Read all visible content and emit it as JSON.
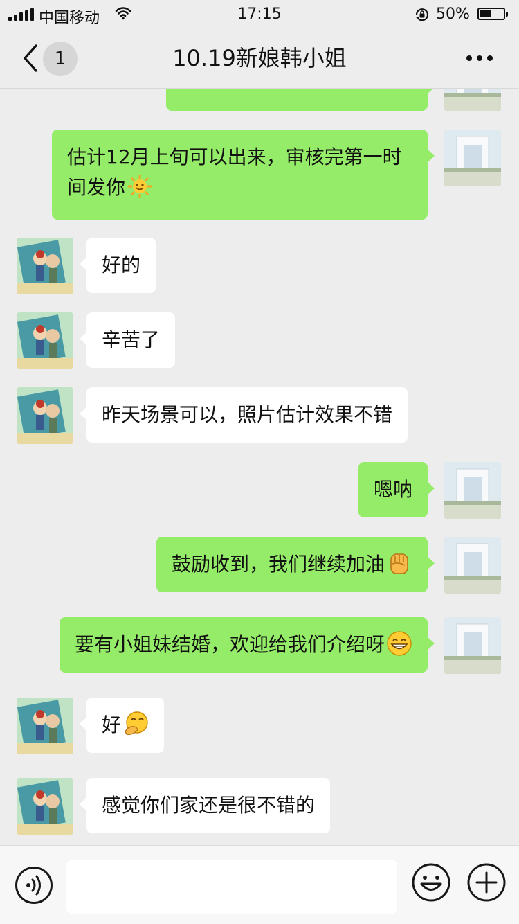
{
  "status_bar": {
    "carrier": "中国移动",
    "time": "17:15",
    "battery_percent": "50%",
    "battery_level": 0.5
  },
  "nav": {
    "unread_count": "1",
    "title": "10.19新娘韩小姐",
    "more_icon": "more-dots-icon",
    "back_icon": "chevron-left-icon"
  },
  "messages": [
    {
      "sender": "me",
      "text": "估计12月上旬可以出来，审核完第一时",
      "text2": "间发你",
      "emoji": "sun-emoji"
    },
    {
      "sender": "other",
      "text": "好的"
    },
    {
      "sender": "other",
      "text": "辛苦了"
    },
    {
      "sender": "other",
      "text": "昨天场景可以，照片估计效果不错"
    },
    {
      "sender": "me",
      "text": "嗯呐"
    },
    {
      "sender": "me",
      "text": "鼓励收到，我们继续加油",
      "emoji": "fist-emoji"
    },
    {
      "sender": "me",
      "text": "要有小姐妹结婚，欢迎给我们介绍呀",
      "emoji": "grin-emoji"
    },
    {
      "sender": "other",
      "text": "好",
      "emoji": "thinking-emoji"
    },
    {
      "sender": "other",
      "text": "感觉你们家还是很不错的"
    }
  ],
  "input_bar": {
    "voice_icon": "voice-icon",
    "emoji_icon": "smiley-icon",
    "plus_icon": "plus-icon",
    "input_value": ""
  },
  "colors": {
    "my_bubble": "#95ec69",
    "other_bubble": "#ffffff",
    "background": "#ededed"
  }
}
